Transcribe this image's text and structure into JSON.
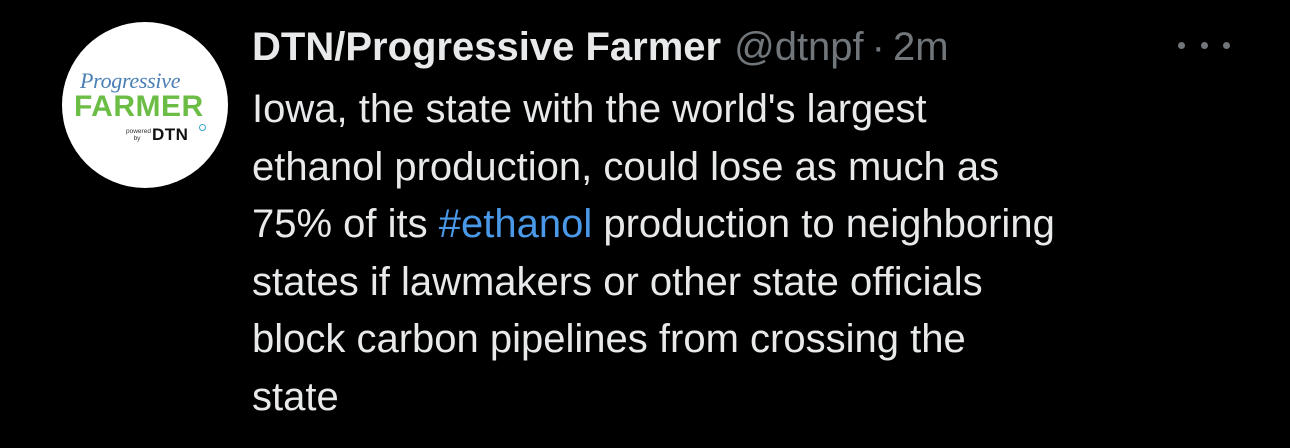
{
  "tweet": {
    "display_name": "DTN/Progressive Farmer",
    "handle": "@dtnpf",
    "separator": "·",
    "time": "2m",
    "more_icon": "more-horizontal-icon",
    "avatar": {
      "logo_line1": "Progressive",
      "logo_line2": "FARMER",
      "logo_powered": "powered\nby",
      "logo_brand": "DTN"
    },
    "text": {
      "line1": "Iowa, the state with the world's largest",
      "line2": "ethanol production, could lose as much as",
      "line3_before": "75% of its ",
      "line3_hashtag": "#ethanol",
      "line3_after": " production to neighboring",
      "line4": "states if lawmakers or other state officials",
      "line5": "block carbon pipelines from crossing the",
      "line6": "state"
    }
  },
  "colors": {
    "background": "#000000",
    "primary_text": "#e7e9ea",
    "secondary_text": "#71767b",
    "link": "#4a99e9",
    "logo_blue": "#4a7fb5",
    "logo_green": "#6bbd45"
  }
}
